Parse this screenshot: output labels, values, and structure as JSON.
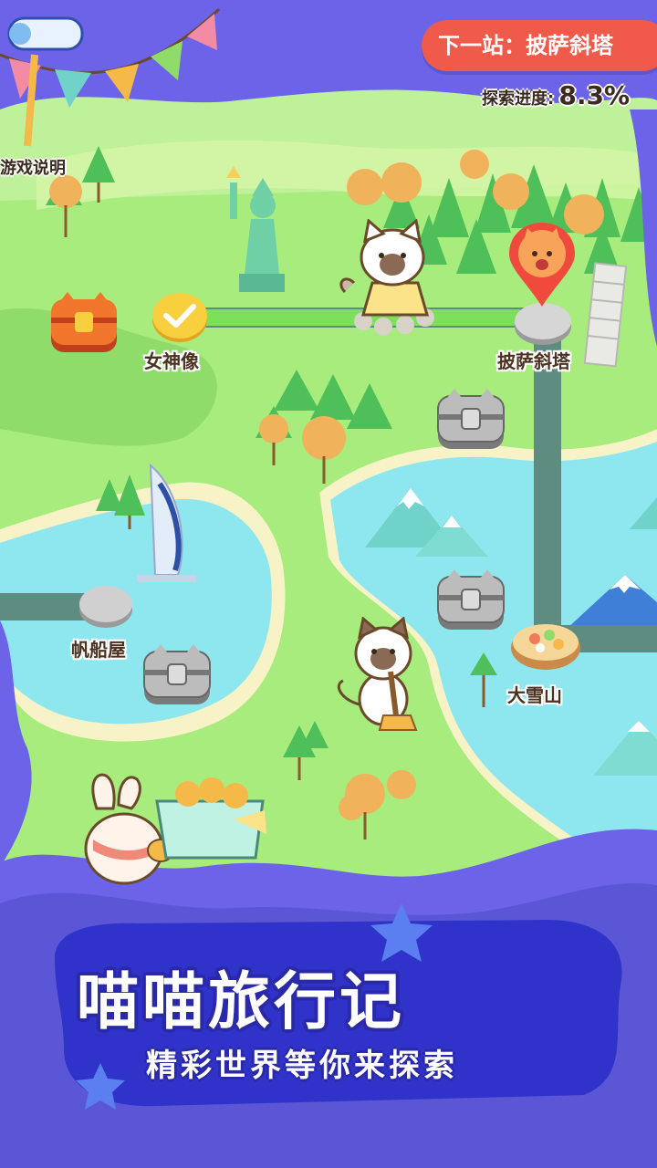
{
  "header": {
    "next_station_label": "下一站：披萨斜塔",
    "progress_label": "探索进度:",
    "progress_value": "8.3%",
    "help_label": "游戏说明"
  },
  "map": {
    "stations": [
      {
        "name": "女神像",
        "status": "completed"
      },
      {
        "name": "披萨斜塔",
        "status": "current"
      },
      {
        "name": "帆船屋",
        "status": "locked"
      },
      {
        "name": "大雪山",
        "status": "locked"
      }
    ],
    "chests": [
      {
        "state": "unlocked"
      },
      {
        "state": "locked"
      },
      {
        "state": "locked"
      },
      {
        "state": "locked"
      }
    ]
  },
  "banner": {
    "title": "喵喵旅行记",
    "subtitle": "精彩世界等你来探索"
  },
  "colors": {
    "land": "#a7ec7c",
    "water": "#8ee7ef",
    "frame": "#6c63e8",
    "path_done": "#7de05a",
    "path_locked": "#5e8c80",
    "pill": "#ef5a4b"
  },
  "icons": [
    "statue-of-liberty-icon",
    "leaning-tower-icon",
    "burj-al-arab-icon",
    "mountain-icon",
    "treasure-chest-icon",
    "checkmark-icon",
    "location-pin-icon",
    "cat-character-icon",
    "rabbit-character-icon",
    "bunting-flags-icon",
    "telescope-icon",
    "star-icon"
  ]
}
